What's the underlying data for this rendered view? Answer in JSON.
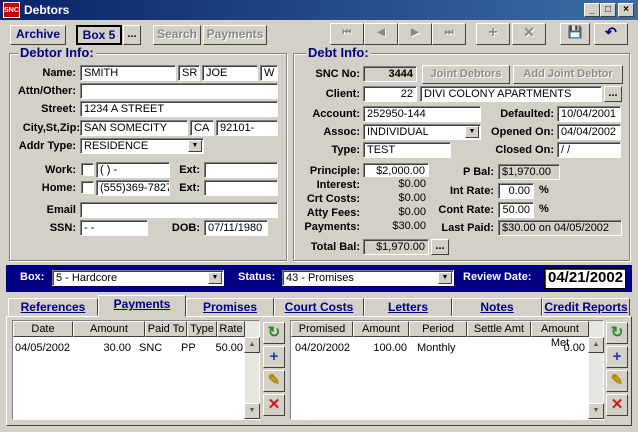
{
  "window": {
    "title": "Debtors",
    "logo": "SNC",
    "min": "_",
    "max": "□",
    "close": "×"
  },
  "toolbar": {
    "archive": "Archive",
    "box": "Box 5",
    "ellipsis": "...",
    "search": "Search",
    "payments": "Payments",
    "first": "⏮",
    "prev": "◀",
    "next": "▶",
    "last": "⏭",
    "add": "+",
    "delete": "✕",
    "save": "💾",
    "undo": "↶"
  },
  "debtor": {
    "section": "Debtor Info:",
    "labels": {
      "name": "Name:",
      "attn": "Attn/Other:",
      "street": "Street:",
      "csz": "City,St,Zip:",
      "addrtype": "Addr Type:",
      "work": "Work:",
      "home": "Home:",
      "ext": "Ext:",
      "email": "Email",
      "ssn": "SSN:",
      "dob": "DOB:"
    },
    "last": "SMITH",
    "suffix": "SR",
    "first": "JOE",
    "mi": "W",
    "attn": "",
    "street": "1234 A STREET",
    "city": "SAN SOMECITY",
    "state": "CA",
    "zip": "92101-",
    "addrtype": "RESIDENCE",
    "work_phone": "(   )    -",
    "work_ext": "",
    "home_phone": "(555)369-7827",
    "home_ext": "",
    "email": "",
    "ssn": " -  -",
    "dob": "07/11/1980"
  },
  "debt": {
    "section": "Debt Info:",
    "labels": {
      "sncno": "SNC No:",
      "client": "Client:",
      "account": "Account:",
      "assoc": "Assoc:",
      "type": "Type:",
      "defaulted": "Defaulted:",
      "opened": "Opened On:",
      "closed": "Closed On:",
      "principle": "Principle:",
      "interest": "Interest:",
      "crtcosts": "Crt Costs:",
      "attyfees": "Atty Fees:",
      "payments": "Payments:",
      "totalbal": "Total Bal:",
      "pbal": "P Bal:",
      "intrate": "Int Rate:",
      "contrate": "Cont Rate:",
      "lastpaid": "Last Paid:",
      "pct1": "%",
      "pct2": "%"
    },
    "joint_debtors": "Joint Debtors",
    "add_joint": "Add Joint Debtor",
    "sncno": "3444",
    "client_no": "22",
    "client_name": "DIVI COLONY APARTMENTS",
    "account": "252950-144",
    "assoc": "INDIVIDUAL",
    "type": "TEST",
    "defaulted": "10/04/2001",
    "opened": "04/04/2002",
    "closed": " /  /",
    "principle": "$2,000.00",
    "interest": "$0.00",
    "crtcosts": "$0.00",
    "attyfees": "$0.00",
    "payments": "$30.00",
    "totalbal": "$1,970.00",
    "pbal": "$1,970.00",
    "intrate": "0.00",
    "contrate": "50.00",
    "lastpaid": "$30.00 on 04/05/2002"
  },
  "statusbar": {
    "box_label": "Box:",
    "box_value": "5 - Hardcore",
    "status_label": "Status:",
    "status_value": "43 - Promises",
    "review_label": "Review Date:",
    "review_value": "04/21/2002"
  },
  "tabs": [
    "References",
    "Payments",
    "Promises",
    "Court Costs",
    "Letters",
    "Notes",
    "Credit Reports"
  ],
  "payments_grid": {
    "headers": [
      "Date",
      "Amount",
      "Paid To",
      "Type",
      "Rate"
    ],
    "rows": [
      [
        "04/05/2002",
        "30.00",
        "SNC",
        "PP",
        "50.00"
      ]
    ]
  },
  "promises_grid": {
    "headers": [
      "Promised",
      "Amount",
      "Period",
      "Settle Amt",
      "Amount Met"
    ],
    "rows": [
      [
        "04/20/2002",
        "100.00",
        "Monthly",
        "",
        "0.00"
      ]
    ]
  },
  "icons": {
    "refresh": "↻",
    "add": "+",
    "edit": "✎",
    "delete": "✕",
    "scroll_up": "▲",
    "scroll_down": "▼",
    "dropdown": "▼"
  }
}
